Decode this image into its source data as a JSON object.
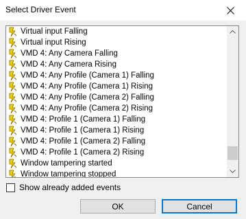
{
  "window": {
    "title": "Select Driver Event"
  },
  "events": [
    "Virtual input Falling",
    "Virtual input Rising",
    "VMD 4: Any Camera Falling",
    "VMD 4: Any Camera Rising",
    "VMD 4: Any Profile (Camera 1) Falling",
    "VMD 4: Any Profile (Camera 1) Rising",
    "VMD 4: Any Profile (Camera 2) Falling",
    "VMD 4: Any Profile (Camera 2) Rising",
    "VMD 4: Profile 1 (Camera 1) Falling",
    "VMD 4: Profile 1 (Camera 1) Rising",
    "VMD 4: Profile 1 (Camera 2) Falling",
    "VMD 4: Profile 1 (Camera 2) Rising",
    "Window tampering started",
    "Window tampering stopped"
  ],
  "checkbox": {
    "label": "Show already added events",
    "checked": false
  },
  "buttons": {
    "ok": "OK",
    "cancel": "Cancel"
  },
  "colors": {
    "bolt": "#f5d300",
    "bolt_outline": "#8a6d00",
    "focus_border": "#0078d7"
  },
  "icons": {
    "event": "lightning-bolt-icon",
    "close": "close-icon"
  }
}
